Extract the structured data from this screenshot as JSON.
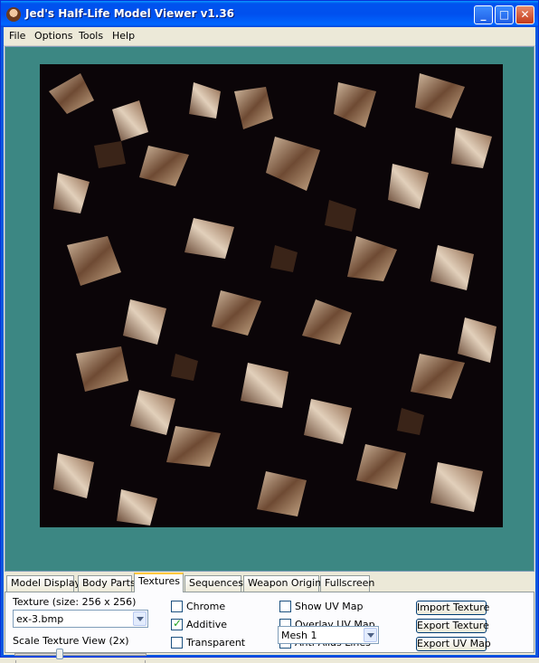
{
  "window": {
    "title": "Jed's Half-Life Model Viewer v1.36"
  },
  "menu": [
    "File",
    "Options",
    "Tools",
    "Help"
  ],
  "tabs": [
    {
      "label": "Model Display",
      "active": false
    },
    {
      "label": "Body Parts",
      "active": false
    },
    {
      "label": "Textures",
      "active": true
    },
    {
      "label": "Sequences",
      "active": false
    },
    {
      "label": "Weapon Origin",
      "active": false
    },
    {
      "label": "Fullscreen",
      "active": false
    }
  ],
  "texture_panel": {
    "size_label": "Texture (size: 256 x 256)",
    "texture_select": "ex-3.bmp",
    "scale_label": "Scale Texture View (2x)",
    "scale_level": 2,
    "checkboxes": {
      "chrome": {
        "label": "Chrome",
        "checked": false
      },
      "additive": {
        "label": "Additive",
        "checked": true
      },
      "transparent": {
        "label": "Transparent",
        "checked": false
      },
      "show_uv": {
        "label": "Show UV Map",
        "checked": false
      },
      "overlay_uv": {
        "label": "Overlay UV Map",
        "checked": false
      },
      "anti_alias": {
        "label": "Anti-Alias Lines",
        "checked": false
      }
    },
    "mesh_select": "Mesh 1",
    "buttons": {
      "import": "Import Texture",
      "export": "Export Texture",
      "export_uv": "Export UV Map"
    }
  },
  "colors": {
    "viewport_bg": "#3c8783",
    "texture_bg": "#0b0508",
    "titlebar": "#0054e3"
  }
}
